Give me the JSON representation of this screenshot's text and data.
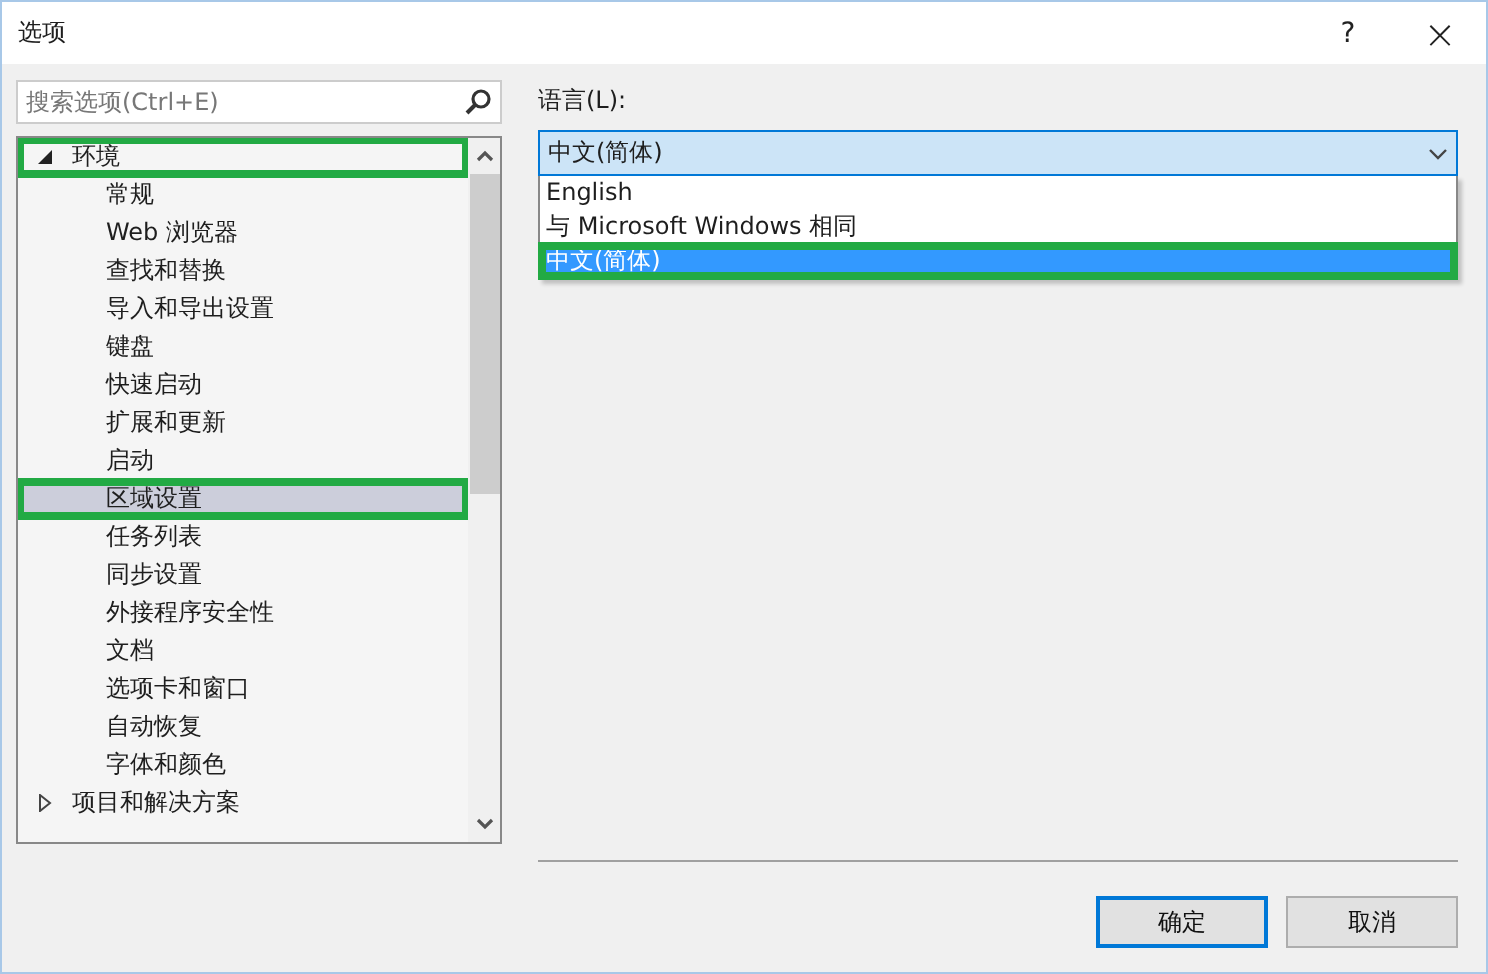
{
  "window": {
    "title": "选项",
    "help": "?",
    "close": "×"
  },
  "search": {
    "placeholder": "搜索选项(Ctrl+E)"
  },
  "tree": [
    {
      "label": "环境",
      "expanded": true,
      "selected": false,
      "highlighted": true,
      "children": [
        {
          "label": "常规",
          "selected": false,
          "highlighted": false
        },
        {
          "label": "Web 浏览器",
          "selected": false,
          "highlighted": false
        },
        {
          "label": "查找和替换",
          "selected": false,
          "highlighted": false
        },
        {
          "label": "导入和导出设置",
          "selected": false,
          "highlighted": false
        },
        {
          "label": "键盘",
          "selected": false,
          "highlighted": false
        },
        {
          "label": "快速启动",
          "selected": false,
          "highlighted": false
        },
        {
          "label": "扩展和更新",
          "selected": false,
          "highlighted": false
        },
        {
          "label": "启动",
          "selected": false,
          "highlighted": false
        },
        {
          "label": "区域设置",
          "selected": true,
          "highlighted": true
        },
        {
          "label": "任务列表",
          "selected": false,
          "highlighted": false
        },
        {
          "label": "同步设置",
          "selected": false,
          "highlighted": false
        },
        {
          "label": "外接程序安全性",
          "selected": false,
          "highlighted": false
        },
        {
          "label": "文档",
          "selected": false,
          "highlighted": false
        },
        {
          "label": "选项卡和窗口",
          "selected": false,
          "highlighted": false
        },
        {
          "label": "自动恢复",
          "selected": false,
          "highlighted": false
        },
        {
          "label": "字体和颜色",
          "selected": false,
          "highlighted": false
        }
      ]
    },
    {
      "label": "项目和解决方案",
      "expanded": false,
      "selected": false,
      "highlighted": false
    }
  ],
  "language": {
    "label": "语言(L):",
    "value": "中文(简体)",
    "options": [
      {
        "label": "English",
        "selected": false,
        "highlighted": false
      },
      {
        "label": "与 Microsoft Windows 相同",
        "selected": false,
        "highlighted": false
      },
      {
        "label": "中文(简体)",
        "selected": true,
        "highlighted": true
      }
    ]
  },
  "buttons": [
    {
      "label": "确定",
      "default": true
    },
    {
      "label": "取消",
      "default": false
    }
  ]
}
